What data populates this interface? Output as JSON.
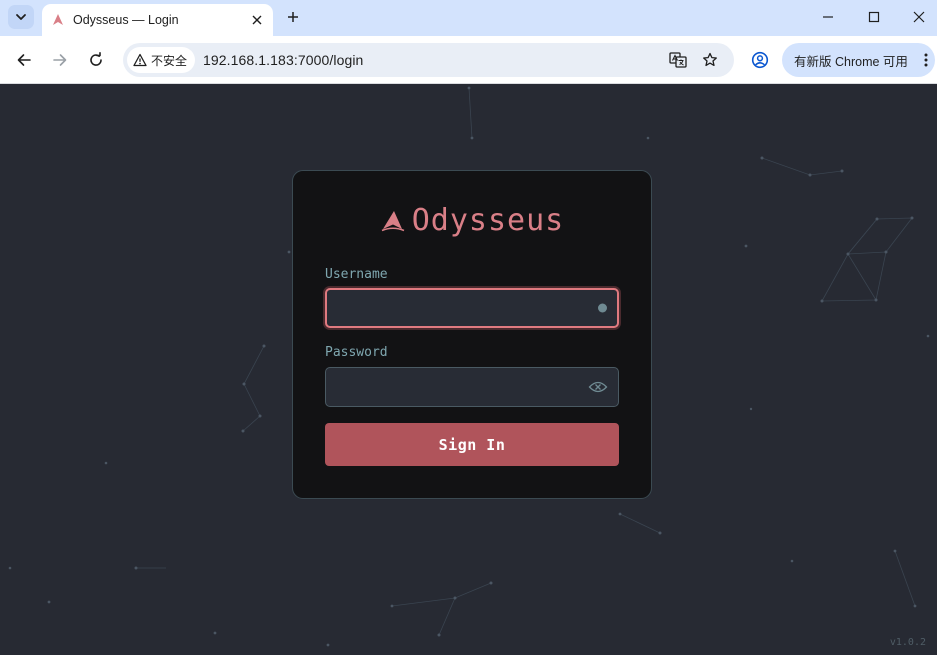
{
  "browser": {
    "tab_title": "Odysseus — Login",
    "security_label": "不安全",
    "url": "192.168.1.183:7000/login",
    "update_label": "有新版 Chrome 可用"
  },
  "login": {
    "brand": "Odysseus",
    "username_label": "Username",
    "username_value": "",
    "password_label": "Password",
    "password_value": "",
    "submit_label": "Sign In"
  },
  "footer": {
    "version": "v1.0.2"
  },
  "colors": {
    "accent": "#d97f87",
    "button": "#b0545b",
    "page_bg": "#272a33",
    "card_bg": "#121214"
  }
}
